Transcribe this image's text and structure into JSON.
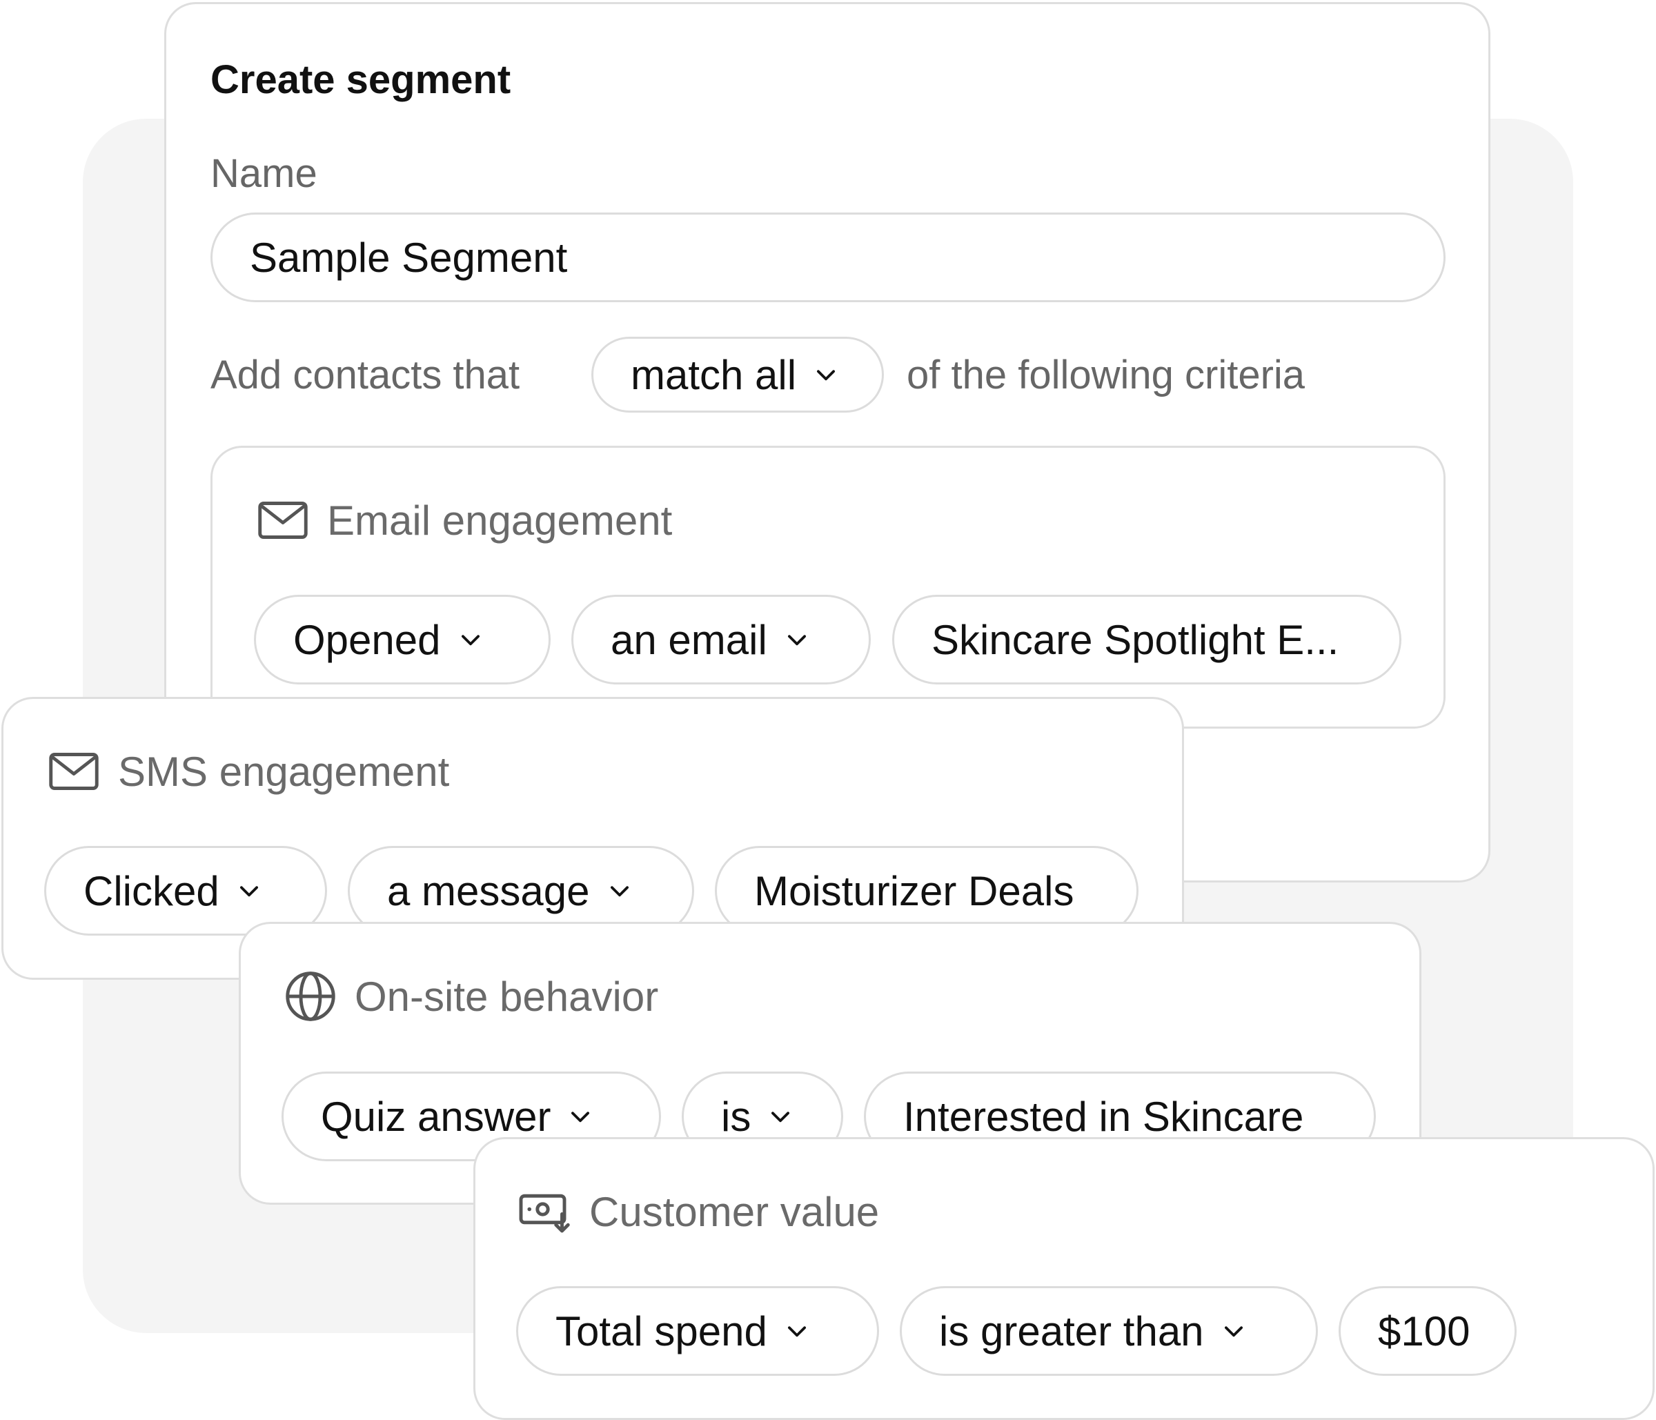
{
  "title": "Create segment",
  "name_label": "Name",
  "name_value": "Sample Segment",
  "criteria_prefix": "Add contacts that",
  "match_select": "match all",
  "criteria_suffix": "of the following criteria",
  "email": {
    "heading": "Email engagement",
    "action": "Opened",
    "object": "an email",
    "value": "Skincare Spotlight E..."
  },
  "sms": {
    "heading": "SMS engagement",
    "action": "Clicked",
    "object": "a message",
    "value": "Moisturizer Deals"
  },
  "onsite": {
    "heading": "On-site behavior",
    "field": "Quiz answer",
    "operator": "is",
    "value": "Interested in Skincare"
  },
  "value": {
    "heading": "Customer value",
    "field": "Total spend",
    "operator": "is greater than",
    "amount": "$100"
  },
  "icons": {
    "email": "envelope-icon",
    "sms": "envelope-icon",
    "onsite": "globe-icon",
    "value": "cash-icon",
    "dropdown": "chevron-down-icon"
  },
  "colors": {
    "border": "#dcdcdc",
    "backdrop": "#f4f4f4",
    "muted_text": "#666666",
    "text": "#111111"
  }
}
